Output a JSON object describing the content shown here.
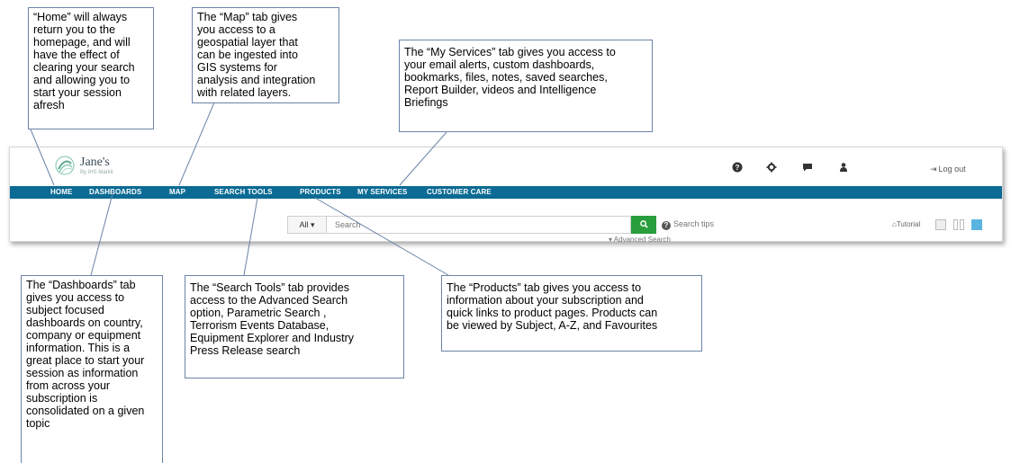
{
  "callouts": {
    "home": [
      "“Home” will always",
      "return you to the",
      "homepage, and will",
      "have the effect of",
      "clearing your search",
      "and allowing you to",
      "start your session",
      "afresh"
    ],
    "map": [
      "The “Map” tab gives",
      "you access to a",
      "geospatial layer that",
      "can be ingested into",
      "GIS systems for",
      "analysis and integration",
      "with related layers."
    ],
    "my_services": [
      "The “My Services” tab gives you access to",
      "your email alerts, custom dashboards,",
      "bookmarks, files, notes, saved searches,",
      "Report Builder, videos and Intelligence",
      "Briefings"
    ],
    "dashboards": [
      "The “Dashboards” tab",
      "gives you access to",
      "subject focused",
      "dashboards on country,",
      "company or equipment",
      "information. This is a",
      "great place to start your",
      "session as information",
      "from across your",
      "subscription is",
      "consolidated on a given",
      "topic"
    ],
    "search_tools": [
      "The “Search Tools” tab provides",
      "access to the Advanced Search",
      "option, Parametric Search ,",
      "Terrorism Events Database,",
      "Equipment Explorer and Industry",
      "Press Release search"
    ],
    "products": [
      "The “Products” tab gives you access to",
      "information about your subscription and",
      "quick links to product pages. Products can",
      "be viewed by Subject, A-Z, and Favourites"
    ]
  },
  "header": {
    "brand_name": "Jane's",
    "brand_sub": "By IHS Markit",
    "logout_label": "Log out",
    "icons": [
      "help-icon",
      "settings-icon",
      "chat-icon",
      "user-icon"
    ]
  },
  "nav": {
    "items": [
      "HOME",
      "DASHBOARDS",
      "MAP",
      "SEARCH TOOLS",
      "PRODUCTS",
      "MY SERVICES",
      "CUSTOMER CARE"
    ]
  },
  "search": {
    "scope_label": "All ▾",
    "placeholder": "Search",
    "tips_label": "Search tips",
    "advanced_label": "▾ Advanced Search"
  },
  "view": {
    "tutorial_label": "Tutorial"
  },
  "colors": {
    "nav_bar": "#0b6b94",
    "search_button": "#2a9d3c",
    "callout_border": "#6b84a8",
    "view_active": "#5ab4e0"
  }
}
